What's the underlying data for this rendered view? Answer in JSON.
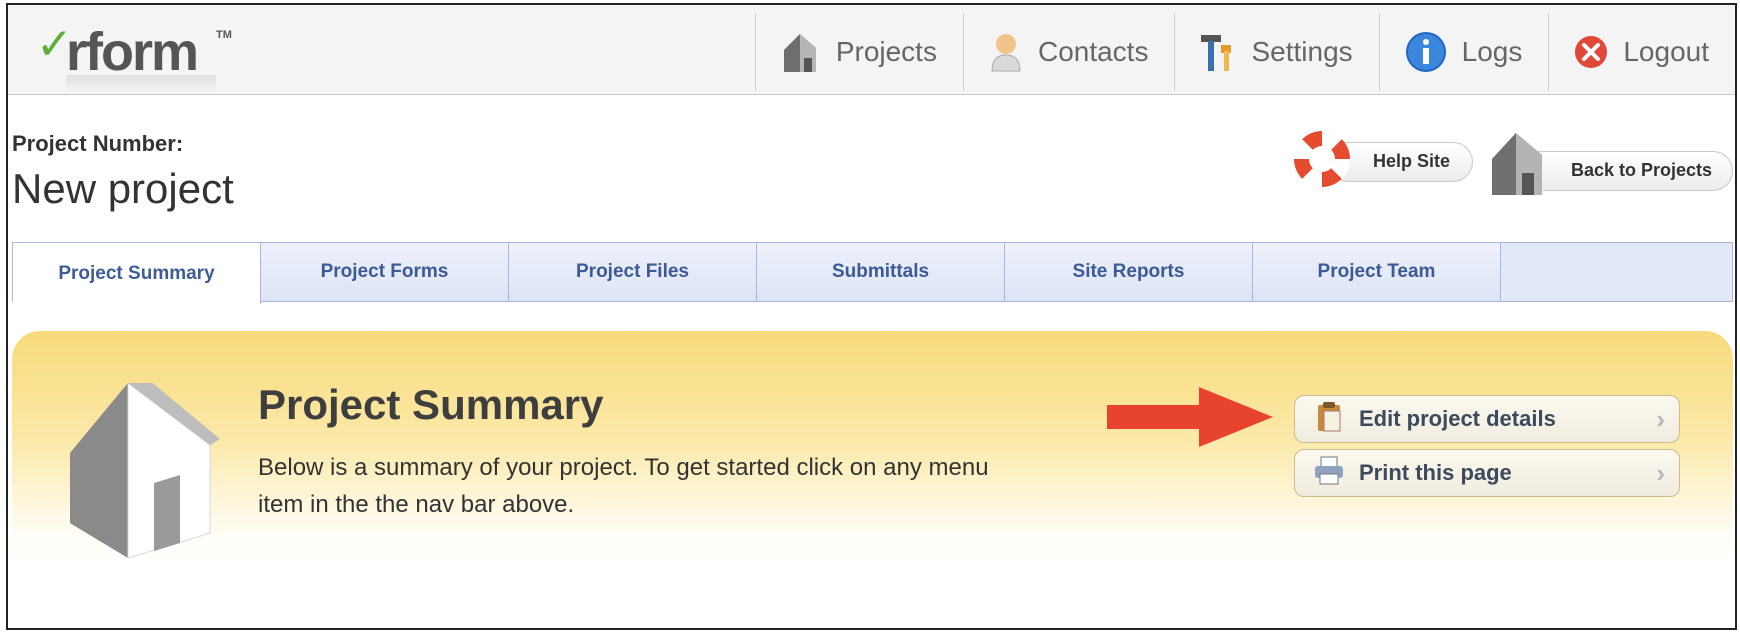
{
  "brand": {
    "logo_check": "✓",
    "logo_word": "rform",
    "logo_tm": "TM"
  },
  "nav": {
    "items": [
      {
        "label": "Projects",
        "icon": "house-icon"
      },
      {
        "label": "Contacts",
        "icon": "person-icon"
      },
      {
        "label": "Settings",
        "icon": "tools-icon"
      },
      {
        "label": "Logs",
        "icon": "info-icon"
      },
      {
        "label": "Logout",
        "icon": "close-icon"
      }
    ]
  },
  "project": {
    "number_label": "Project Number:",
    "name": "New project"
  },
  "header_buttons": {
    "help": "Help Site",
    "back": "Back to Projects"
  },
  "tabs": [
    {
      "label": "Project Summary",
      "active": true
    },
    {
      "label": "Project Forms"
    },
    {
      "label": "Project Files"
    },
    {
      "label": "Submittals"
    },
    {
      "label": "Site Reports"
    },
    {
      "label": "Project Team"
    }
  ],
  "summary": {
    "title": "Project Summary",
    "description": "Below is a summary of your project. To get started click on any menu item in the the nav bar above.",
    "actions": {
      "edit": "Edit project details",
      "print": "Print this page"
    }
  },
  "colors": {
    "accent_arrow": "#e8432f",
    "tab_text": "#3c5a96",
    "panel_yellow": "#f8da7c"
  }
}
